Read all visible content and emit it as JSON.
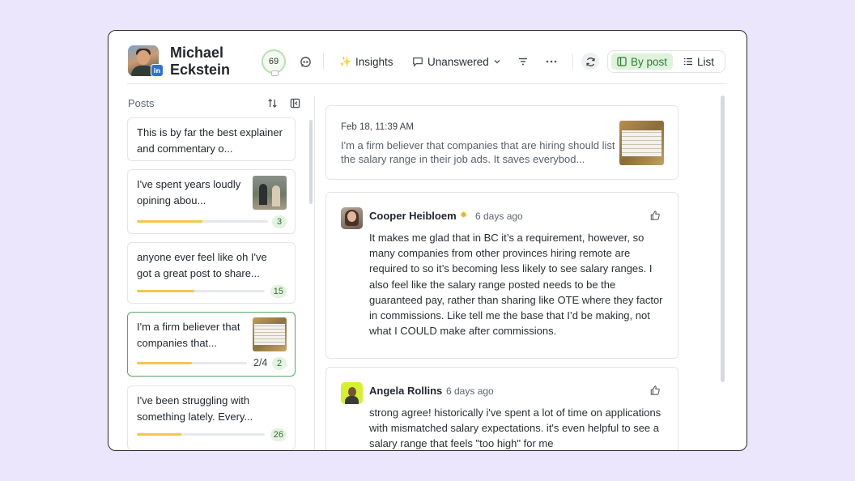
{
  "header": {
    "user_name": "Michael Eckstein",
    "avatar_badge": "in",
    "score": "69",
    "insights_label": "Insights",
    "unanswered_label": "Unanswered",
    "view_by_post": "By post",
    "view_list": "List"
  },
  "posts_panel": {
    "title": "Posts",
    "posts": [
      {
        "text": "This is by far the best explainer and commentary o...",
        "count": ""
      },
      {
        "text": "I've spent years loudly opining abou...",
        "count": "3",
        "progress": 0.5
      },
      {
        "text": "anyone ever feel like oh I've got a great post to share...",
        "count": "15",
        "progress": 0.45
      },
      {
        "text": "I'm a firm believer that companies that...",
        "count": "2",
        "ratio": "2/4",
        "progress": 0.5
      },
      {
        "text": "I've been struggling with something lately. Every...",
        "count": "26",
        "progress": 0.35
      }
    ]
  },
  "original_post": {
    "date": "Feb 18, 11:39 AM",
    "text": "I'm a firm believer that companies that are hiring should list the salary range in their job ads. It saves everybod..."
  },
  "comments": [
    {
      "name": "Cooper Heibloem",
      "time": "6 days ago",
      "text": "It makes me glad that in BC it’s a requirement, however, so many companies from other provinces hiring remote are required to so it’s becoming less likely to see salary ranges. I also feel like the salary range posted needs to be the guaranteed pay, rather than sharing like OTE where they factor in commissions. Like tell me the base that I’d be making, not what I COULD make after commissions."
    },
    {
      "name": "Angela Rollins",
      "time": "6 days ago",
      "text": "strong agree! historically i've spent a lot of time on applications with mismatched salary expectations. it's even helpful to see a salary range that feels \"too high\" for me"
    }
  ],
  "colors": {
    "background": "#ebe6fb",
    "accent_green": "#2e7d35",
    "progress": "#f6c54c",
    "linkedin": "#2f6fd6"
  }
}
